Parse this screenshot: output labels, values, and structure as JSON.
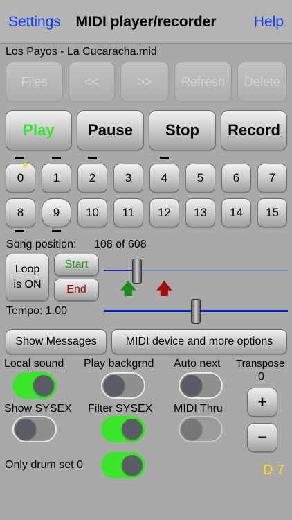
{
  "nav": {
    "settings": "Settings",
    "title": "MIDI player/recorder",
    "help": "Help"
  },
  "file_name": "Los Payos - La Cucaracha.mid",
  "file_buttons": {
    "files": "Files",
    "prev": "<<",
    "next": ">>",
    "refresh": "Refresh",
    "delete": "Delete"
  },
  "transport": {
    "play": "Play",
    "pause": "Pause",
    "stop": "Stop",
    "record": "Record"
  },
  "channels": [
    "0",
    "1",
    "2",
    "3",
    "4",
    "5",
    "6",
    "7",
    "8",
    "9",
    "10",
    "11",
    "12",
    "13",
    "14",
    "15"
  ],
  "song_position": {
    "label": "Song position:",
    "value": "108 of 608",
    "current": 108,
    "total": 608
  },
  "loop": {
    "line1": "Loop",
    "line2": "is ON",
    "start": "Start",
    "end": "End"
  },
  "tempo": {
    "label": "Tempo: 1.00",
    "value": 1.0
  },
  "buttons": {
    "show_messages": "Show Messages",
    "midi_device": "MIDI device and more options"
  },
  "toggles": {
    "local_sound": {
      "label": "Local sound",
      "on": true
    },
    "play_background": {
      "label": "Play backgrnd",
      "on": false
    },
    "auto_next": {
      "label": "Auto next",
      "on": false
    },
    "show_sysex": {
      "label": "Show SYSEX",
      "on": false
    },
    "filter_sysex": {
      "label": "Filter SYSEX",
      "on": true
    },
    "midi_thru": {
      "label": "MIDI Thru",
      "on": false
    },
    "only_drum_set": {
      "label": "Only drum set 0",
      "on": true
    }
  },
  "transpose": {
    "label": "Transpose",
    "value": "0",
    "plus": "+",
    "minus": "−"
  },
  "status": "D 7",
  "colors": {
    "accent_link": "#0a3cff",
    "play_green": "#32e632",
    "toggle_on": "#3be62a",
    "start_green": "#1e8a1e",
    "end_red": "#a01010",
    "status_yellow": "#ffe000",
    "track_blue": "#0028c8"
  },
  "icons": {
    "start_marker": "green-up-arrow-icon",
    "end_marker": "red-up-arrow-icon"
  }
}
